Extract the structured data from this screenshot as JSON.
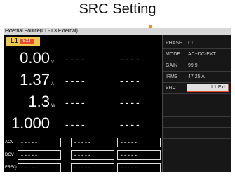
{
  "callout": {
    "title": "SRC Setting",
    "accent": "#f28c28"
  },
  "screen": {
    "title": "External Source(L1 - L3 External)",
    "channel": {
      "label": "L1",
      "badge": "EXT"
    },
    "measurements": [
      {
        "value": "0.00",
        "unit": "V",
        "dash1": "----",
        "dash2": "----"
      },
      {
        "value": "1.37",
        "unit": "A",
        "dash1": "----",
        "dash2": "----"
      },
      {
        "value": "1.3",
        "unit": "W",
        "dash1": "----",
        "dash2": "----"
      },
      {
        "value": "1.000",
        "unit": "",
        "dash1": "----",
        "dash2": "----"
      }
    ],
    "inputs": [
      {
        "label": "ACV",
        "values": [
          "-----",
          "-----",
          "-----"
        ]
      },
      {
        "label": "DCV",
        "values": [
          "-----",
          "-----",
          "-----"
        ]
      },
      {
        "label": "FREQ",
        "values": [
          "-----",
          "-----",
          "-----"
        ]
      }
    ],
    "params": [
      {
        "key": "PHASE",
        "value": "L1"
      },
      {
        "key": "MODE",
        "value": "AC+DC-EXT"
      },
      {
        "key": "GAIN",
        "value": "99.9"
      },
      {
        "key": "IRMS",
        "value": "47.25 A"
      }
    ],
    "src": {
      "key": "SRC",
      "value": "L1 Ext"
    },
    "colors": {
      "badge": "#e94b2b",
      "tab": "#f0c84a",
      "background": "#000000",
      "panel": "#171717"
    }
  }
}
